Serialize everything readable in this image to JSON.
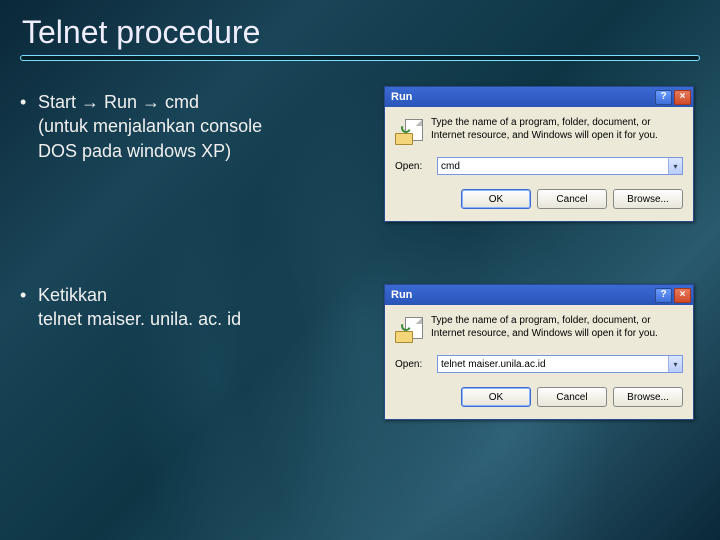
{
  "slide": {
    "title": "Telnet procedure",
    "bullets": [
      {
        "line1_prefix": "Start ",
        "line1_mid": " Run ",
        "line1_suffix": " cmd",
        "line2": "(untuk menjalankan console",
        "line3": "DOS pada windows XP)"
      },
      {
        "line1": "Ketikkan",
        "line2": "telnet maiser. unila. ac. id"
      }
    ],
    "arrow_glyph": "→"
  },
  "dialogs": [
    {
      "title": "Run",
      "help_glyph": "?",
      "close_glyph": "×",
      "description": "Type the name of a program, folder, document, or Internet resource, and Windows will open it for you.",
      "open_label": "Open:",
      "input_value": "cmd",
      "dropdown_glyph": "▾",
      "buttons": {
        "ok": "OK",
        "cancel": "Cancel",
        "browse": "Browse..."
      }
    },
    {
      "title": "Run",
      "help_glyph": "?",
      "close_glyph": "×",
      "description": "Type the name of a program, folder, document, or Internet resource, and Windows will open it for you.",
      "open_label": "Open:",
      "input_value": "telnet maiser.unila.ac.id",
      "dropdown_glyph": "▾",
      "buttons": {
        "ok": "OK",
        "cancel": "Cancel",
        "browse": "Browse..."
      }
    }
  ]
}
